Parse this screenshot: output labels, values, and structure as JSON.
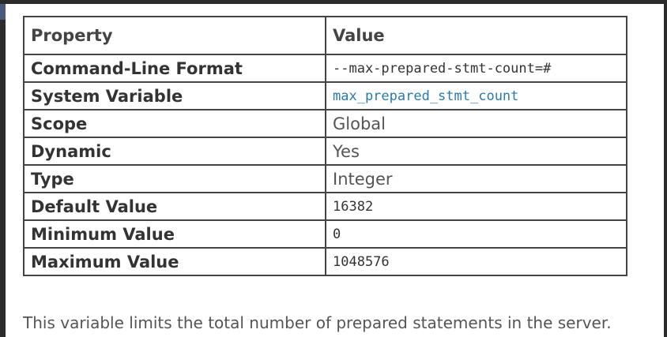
{
  "table": {
    "headers": {
      "property": "Property",
      "value": "Value"
    },
    "rows": [
      {
        "property": "Command-Line Format",
        "value": "--max-prepared-stmt-count=#"
      },
      {
        "property": "System Variable",
        "value": "max_prepared_stmt_count"
      },
      {
        "property": "Scope",
        "value": "Global"
      },
      {
        "property": "Dynamic",
        "value": "Yes"
      },
      {
        "property": "Type",
        "value": "Integer"
      },
      {
        "property": "Default Value",
        "value": "16382"
      },
      {
        "property": "Minimum Value",
        "value": "0"
      },
      {
        "property": "Maximum Value",
        "value": "1048576"
      }
    ]
  },
  "description": "This variable limits the total number of prepared statements in the server.",
  "colors": {
    "link": "#2a7ab0",
    "border": "#444444",
    "text": "#555555"
  }
}
